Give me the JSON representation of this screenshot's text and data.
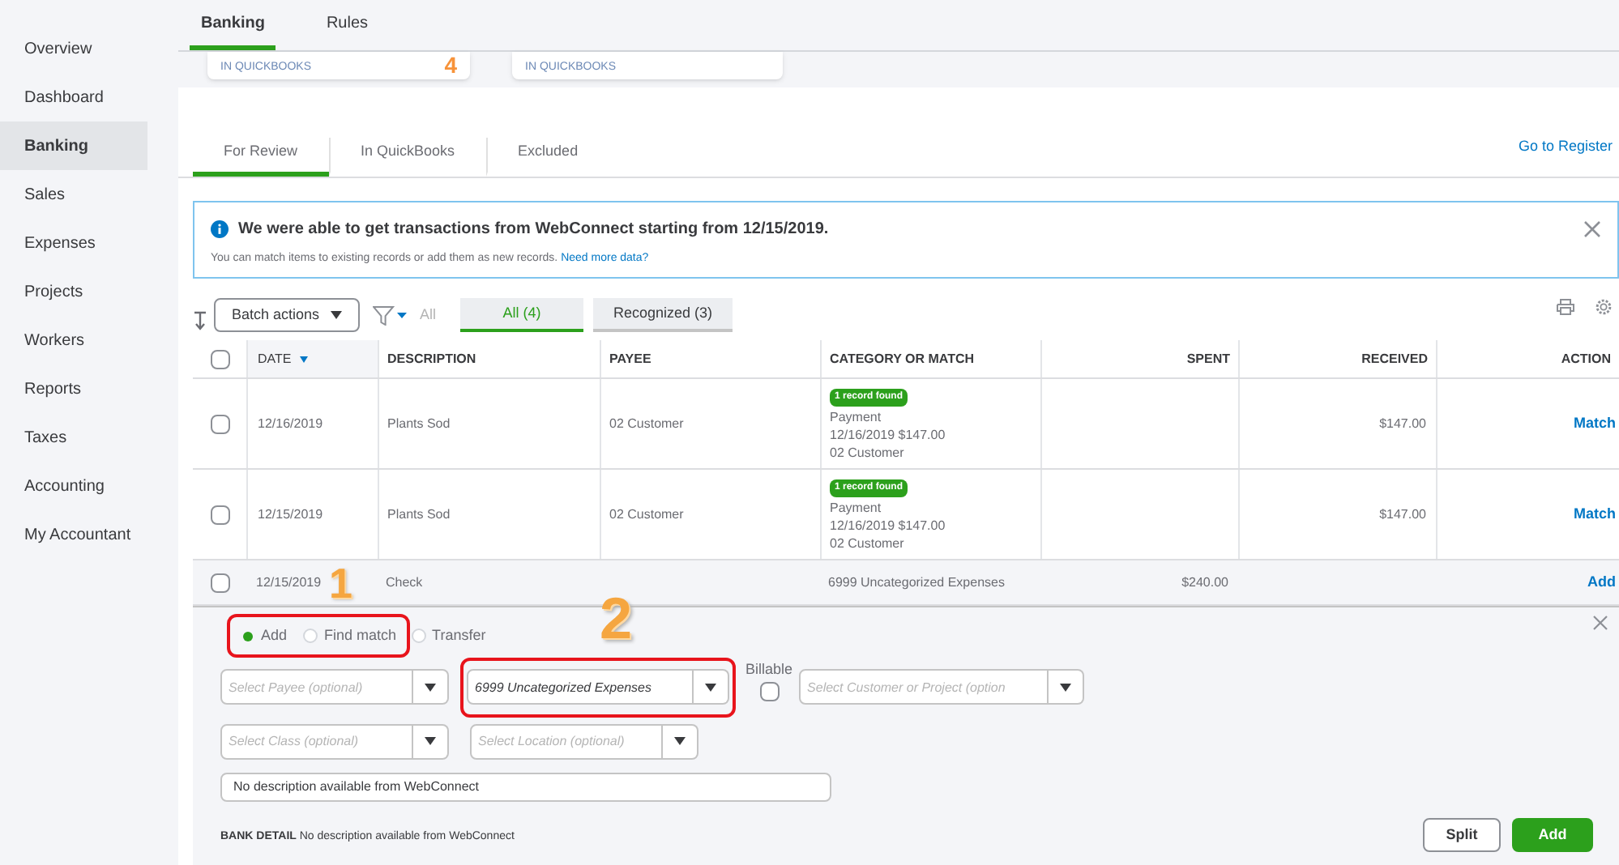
{
  "sidebar": {
    "items": [
      {
        "label": "Overview",
        "selected": false
      },
      {
        "label": "Dashboard",
        "selected": false
      },
      {
        "label": "Banking",
        "selected": true
      },
      {
        "label": "Sales",
        "selected": false
      },
      {
        "label": "Expenses",
        "selected": false
      },
      {
        "label": "Projects",
        "selected": false
      },
      {
        "label": "Workers",
        "selected": false
      },
      {
        "label": "Reports",
        "selected": false
      },
      {
        "label": "Taxes",
        "selected": false
      },
      {
        "label": "Accounting",
        "selected": false
      },
      {
        "label": "My Accountant",
        "selected": false
      }
    ]
  },
  "top_tabs": [
    {
      "label": "Banking",
      "selected": true
    },
    {
      "label": "Rules",
      "selected": false
    }
  ],
  "summary_cards": [
    {
      "caption": "IN QUICKBOOKS",
      "count": "4"
    },
    {
      "caption": "IN QUICKBOOKS"
    }
  ],
  "review_tabs": [
    {
      "label": "For Review",
      "selected": true
    },
    {
      "label": "In QuickBooks",
      "selected": false
    },
    {
      "label": "Excluded",
      "selected": false
    }
  ],
  "register_link": "Go to Register",
  "alert": {
    "title": "We were able to get transactions from WebConnect starting from 12/15/2019.",
    "body": "You can match items to existing records or add them as new records.",
    "link": "Need more data?"
  },
  "toolbar": {
    "batch_actions": "Batch actions",
    "filter_label": "All",
    "filters": [
      {
        "label": "All (4)",
        "selected": true
      },
      {
        "label": "Recognized (3)",
        "selected": false
      }
    ]
  },
  "table": {
    "select_all": {
      "checked": false
    },
    "columns": [
      "DATE",
      "DESCRIPTION",
      "PAYEE",
      "CATEGORY OR MATCH",
      "SPENT",
      "RECEIVED",
      "ACTION"
    ],
    "rows": [
      {
        "checked": false,
        "expanded": false,
        "date": "12/16/2019",
        "description": "Plants Sod",
        "payee": "02 Customer",
        "category": {
          "kind": "match",
          "badge": "1 record found",
          "lines": [
            "Payment",
            "12/16/2019 $147.00",
            "02 Customer"
          ]
        },
        "received": "$147.00",
        "action": "Match"
      },
      {
        "checked": false,
        "expanded": false,
        "date": "12/15/2019",
        "description": "Plants Sod",
        "payee": "02 Customer",
        "category": {
          "kind": "match",
          "badge": "1 record found",
          "lines": [
            "Payment",
            "12/16/2019 $147.00",
            "02 Customer"
          ]
        },
        "received": "$147.00",
        "action": "Match"
      },
      {
        "checked": false,
        "expanded": true,
        "date": "12/15/2019",
        "description": "Check",
        "category": {
          "kind": "text",
          "text": "6999 Uncategorized Expenses"
        },
        "spent": "$240.00",
        "action": "Add"
      }
    ]
  },
  "editor": {
    "modes": [
      {
        "label": "Add",
        "selected": true
      },
      {
        "label": "Find match",
        "selected": false
      },
      {
        "label": "Transfer",
        "selected": false
      }
    ],
    "payee": {
      "placeholder": "Select Payee (optional)"
    },
    "category": {
      "value": "6999 Uncategorized Expenses"
    },
    "billable": {
      "label": "Billable",
      "checked": false
    },
    "customer": {
      "placeholder": "Select Customer or Project (option"
    },
    "class": {
      "placeholder": "Select Class (optional)"
    },
    "location": {
      "placeholder": "Select Location (optional)"
    },
    "memo": {
      "value": "No description available from WebConnect"
    },
    "bank_detail": {
      "label": "BANK DETAIL",
      "text": "No description available from WebConnect"
    },
    "buttons": [
      {
        "label": "Split",
        "kind": "secondary"
      },
      {
        "label": "Add",
        "kind": "primary"
      }
    ]
  },
  "annotations": [
    {
      "label": "1"
    },
    {
      "label": "2"
    }
  ]
}
